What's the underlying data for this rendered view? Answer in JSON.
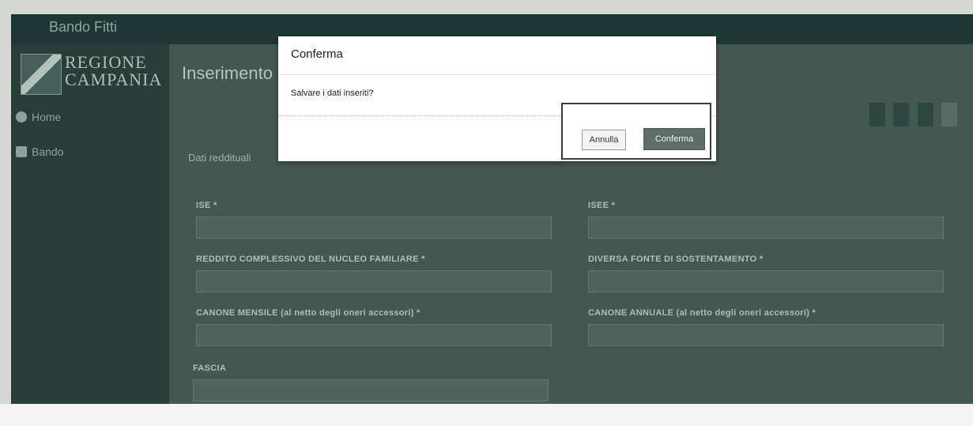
{
  "header": {
    "app_title": "Bando Fitti",
    "right_text": ""
  },
  "sidebar": {
    "logo_line1": "REGIONE",
    "logo_line2": "CAMPANIA",
    "items": [
      {
        "label": "Home",
        "icon": "home-icon"
      },
      {
        "label": "Bando",
        "icon": "document-icon"
      }
    ]
  },
  "main": {
    "page_title": "Inserimento",
    "top_buttons": [
      "",
      "",
      "",
      ""
    ],
    "section_title": "Dati reddituali",
    "section_note": "",
    "fields": {
      "ise": {
        "label": "ISE *",
        "value": ""
      },
      "isee": {
        "label": "ISEE *",
        "value": ""
      },
      "reddito": {
        "label": "REDDITO COMPLESSIVO DEL NUCLEO FAMILIARE *",
        "value": ""
      },
      "fonte": {
        "label": "DIVERSA FONTE DI SOSTENTAMENTO *",
        "value": ""
      },
      "canone_mensile": {
        "label": "CANONE MENSILE (al netto degli oneri accessori) *",
        "value": ""
      },
      "canone_annuale": {
        "label": "CANONE ANNUALE (al netto degli oneri accessori) *",
        "value": ""
      },
      "fascia": {
        "label": "FASCIA",
        "value": ""
      }
    }
  },
  "modal": {
    "title": "Conferma",
    "message": "Salvare i dati inseriti?",
    "cancel_label": "Annulla",
    "confirm_label": "Conferma"
  }
}
